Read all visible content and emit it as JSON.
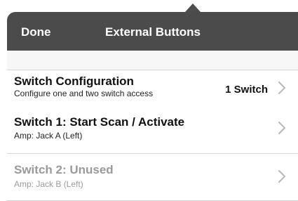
{
  "navbar": {
    "done_label": "Done",
    "title": "External Buttons"
  },
  "rows": [
    {
      "title": "Switch Configuration",
      "subtitle": "Configure one and two switch access",
      "value": "1 Switch",
      "enabled": true
    },
    {
      "title": "Switch 1: Start Scan / Activate",
      "subtitle": "Amp: Jack A (Left)",
      "enabled": true
    },
    {
      "title": "Switch 2: Unused",
      "subtitle": "Amp: Jack B (Left)",
      "enabled": false
    }
  ],
  "colors": {
    "navbar_bg": "#4b4b4b",
    "navbar_text": "#ffffff",
    "disabled_text": "#9a9a9a",
    "chevron": "#b8b8b8"
  },
  "icons": {
    "row_disclosure": "chevron-right-icon",
    "popover_arrow": "popover-arrow"
  }
}
